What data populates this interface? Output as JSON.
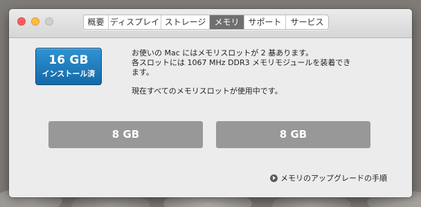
{
  "window": {
    "tabs": [
      {
        "label": "概要",
        "active": false
      },
      {
        "label": "ディスプレイ",
        "active": false
      },
      {
        "label": "ストレージ",
        "active": false
      },
      {
        "label": "メモリ",
        "active": true
      },
      {
        "label": "サポート",
        "active": false
      },
      {
        "label": "サービス",
        "active": false
      }
    ]
  },
  "memory": {
    "badge_size": "16 GB",
    "badge_label": "インストール済",
    "info_line1": "お使いの Mac にはメモリスロットが 2 基あります。",
    "info_line2": "各スロットには 1067 MHz DDR3 メモリモジュールを装着でき",
    "info_line3": "ます。",
    "info_line4": "現在すべてのメモリスロットが使用中です。",
    "slots": [
      {
        "label": "8 GB"
      },
      {
        "label": "8 GB"
      }
    ],
    "upgrade_link": "メモリのアップグレードの手順"
  },
  "colors": {
    "accent": "#1f7fc2",
    "active_tab": "#6f6f6f",
    "slot": "#989898"
  },
  "icons": {
    "upgrade": "arrow-right-circle-icon"
  }
}
